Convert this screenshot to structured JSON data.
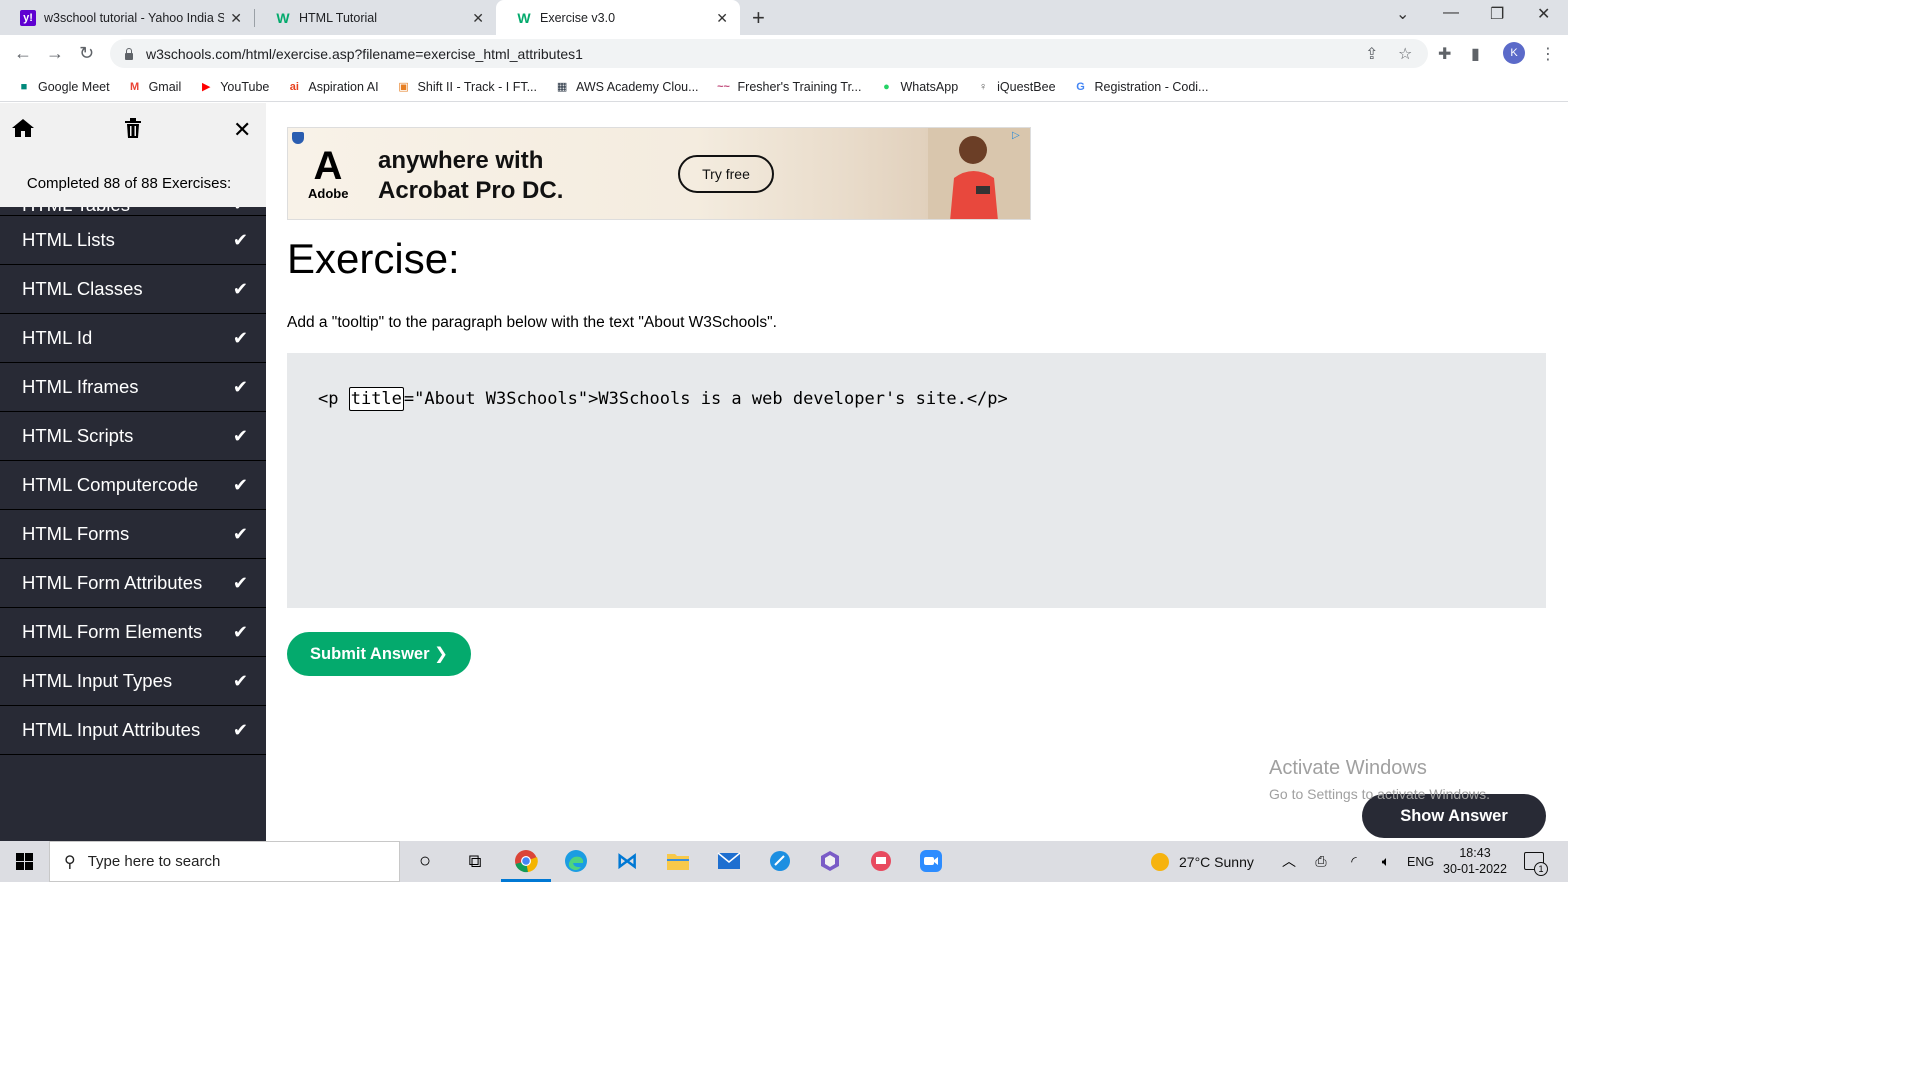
{
  "browser": {
    "tabs": [
      {
        "title": "w3school tutorial - Yahoo India S",
        "favicon": "yahoo-icon"
      },
      {
        "title": "HTML Tutorial",
        "favicon": "w3schools-icon"
      },
      {
        "title": "Exercise v3.0",
        "favicon": "w3schools-icon",
        "active": true
      }
    ],
    "url": "w3schools.com/html/exercise.asp?filename=exercise_html_attributes1",
    "profile_initial": "K"
  },
  "bookmarks": [
    {
      "label": "Google Meet",
      "icon": "google-meet-icon"
    },
    {
      "label": "Gmail",
      "icon": "gmail-icon"
    },
    {
      "label": "YouTube",
      "icon": "youtube-icon"
    },
    {
      "label": "Aspiration AI",
      "icon": "aspiration-ai-icon"
    },
    {
      "label": "Shift II - Track - I FT...",
      "icon": "shift-icon"
    },
    {
      "label": "AWS Academy Clou...",
      "icon": "aws-icon"
    },
    {
      "label": "Fresher's Training Tr...",
      "icon": "training-icon"
    },
    {
      "label": "WhatsApp",
      "icon": "whatsapp-icon"
    },
    {
      "label": "iQuestBee",
      "icon": "iquestbee-icon"
    },
    {
      "label": "Registration - Codi...",
      "icon": "google-icon"
    }
  ],
  "sidebar": {
    "completed_text": "Completed 88 of 88 Exercises:",
    "partial_item": "HTML Tables",
    "items": [
      {
        "label": "HTML Lists"
      },
      {
        "label": "HTML Classes"
      },
      {
        "label": "HTML Id"
      },
      {
        "label": "HTML Iframes"
      },
      {
        "label": "HTML Scripts"
      },
      {
        "label": "HTML Computercode"
      },
      {
        "label": "HTML Forms"
      },
      {
        "label": "HTML Form Attributes"
      },
      {
        "label": "HTML Form Elements"
      },
      {
        "label": "HTML Input Types"
      },
      {
        "label": "HTML Input Attributes"
      }
    ]
  },
  "ad": {
    "brand": "Adobe",
    "line1": "anywhere with",
    "line2": "Acrobat Pro DC.",
    "cta": "Try free"
  },
  "exercise": {
    "title": "Exercise:",
    "instruction": "Add a \"tooltip\" to the paragraph below with the text \"About W3Schools\".",
    "code_before": "<p ",
    "input_value": "title",
    "code_after": "=\"About W3Schools\">W3Schools is a web developer's site.</p>",
    "show_answer_label": "Show Answer",
    "submit_label": "Submit Answer ❯"
  },
  "watermark": {
    "line1": "Activate Windows",
    "line2": "Go to Settings to activate Windows."
  },
  "taskbar": {
    "search_placeholder": "Type here to search",
    "weather": "27°C  Sunny",
    "language": "ENG",
    "time": "18:43",
    "date": "30-01-2022",
    "notification_count": "1"
  }
}
